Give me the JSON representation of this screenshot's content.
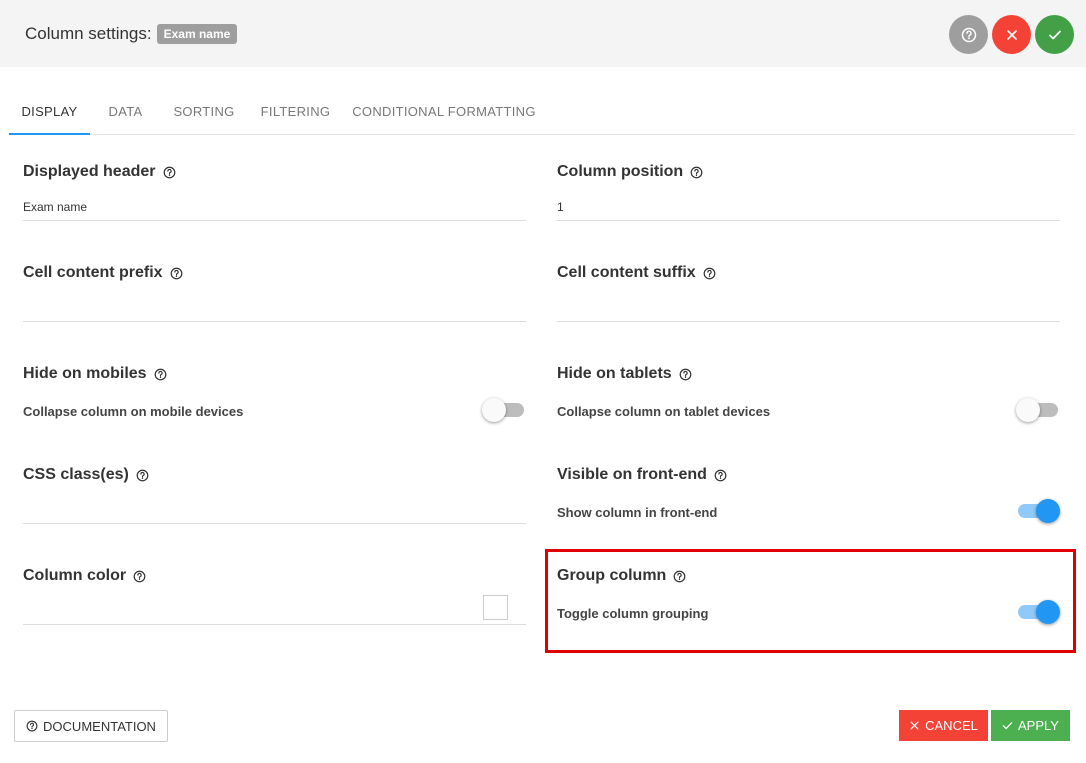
{
  "header": {
    "title": "Column settings:",
    "badge": "Exam name"
  },
  "tabs": [
    {
      "label": "DISPLAY",
      "active": true
    },
    {
      "label": "DATA",
      "active": false
    },
    {
      "label": "SORTING",
      "active": false
    },
    {
      "label": "FILTERING",
      "active": false
    },
    {
      "label": "CONDITIONAL FORMATTING",
      "active": false
    }
  ],
  "fields": {
    "displayed_header": {
      "label": "Displayed header",
      "value": "Exam name"
    },
    "column_position": {
      "label": "Column position",
      "value": "1"
    },
    "cell_prefix": {
      "label": "Cell content prefix",
      "value": ""
    },
    "cell_suffix": {
      "label": "Cell content suffix",
      "value": ""
    },
    "hide_mobiles": {
      "label": "Hide on mobiles",
      "sub": "Collapse column on mobile devices",
      "on": false
    },
    "hide_tablets": {
      "label": "Hide on tablets",
      "sub": "Collapse column on tablet devices",
      "on": false
    },
    "css_classes": {
      "label": "CSS class(es)",
      "value": ""
    },
    "visible_frontend": {
      "label": "Visible on front-end",
      "sub": "Show column in front-end",
      "on": true
    },
    "column_color": {
      "label": "Column color",
      "value": ""
    },
    "group_column": {
      "label": "Group column",
      "sub": "Toggle column grouping",
      "on": true
    }
  },
  "footer": {
    "documentation": "DOCUMENTATION",
    "cancel": "CANCEL",
    "apply": "APPLY"
  },
  "colors": {
    "accent": "#2196f3",
    "danger": "#f44336",
    "success": "#4caf50",
    "highlight": "#e00000"
  }
}
